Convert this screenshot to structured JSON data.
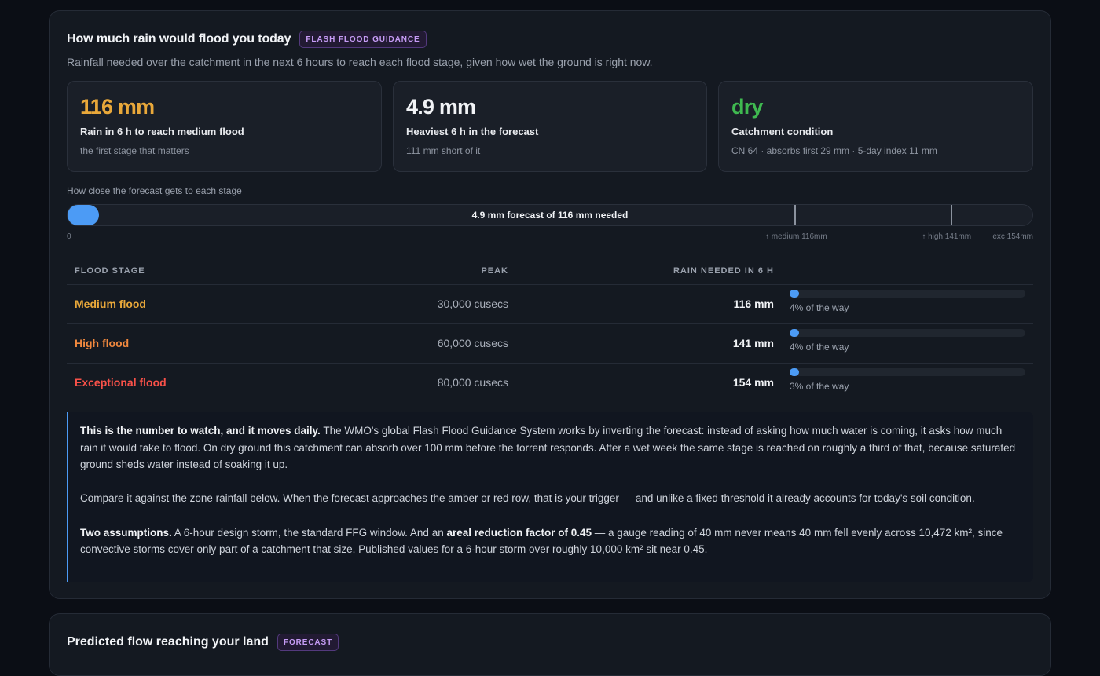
{
  "guidance": {
    "title": "How much rain would flood you today",
    "badge": "FLASH FLOOD GUIDANCE",
    "subtitle": "Rainfall needed over the catchment in the next 6 hours to reach each flood stage, given how wet the ground is right now."
  },
  "stats": [
    {
      "value": "116 mm",
      "label": "Rain in 6 h to reach medium flood",
      "sub": "the first stage that matters",
      "color": "#e9a83a"
    },
    {
      "value": "4.9 mm",
      "label": "Heaviest 6 h in the forecast",
      "sub": "111 mm short of it",
      "color": "#f1f3f6"
    },
    {
      "value": "dry",
      "label": "Catchment condition",
      "sub": "CN 64 · absorbs first 29 mm · 5-day index 11 mm",
      "color": "#3fb950"
    }
  ],
  "gauge": {
    "caption": "How close the forecast gets to each stage",
    "label": "4.9 mm forecast of 116 mm needed",
    "forecast_mm": 4.9,
    "max_mm": 154,
    "zero_label": "0",
    "markers": [
      {
        "label": "↑ medium 116mm",
        "mm": 116
      },
      {
        "label": "↑ high 141mm",
        "mm": 141
      }
    ],
    "end_label": "exc 154mm"
  },
  "table": {
    "headers": {
      "stage": "FLOOD STAGE",
      "peak": "PEAK",
      "need": "RAIN NEEDED IN 6 H"
    },
    "rows": [
      {
        "stage": "Medium flood",
        "color": "#e9a83a",
        "peak": "30,000 cusecs",
        "need": "116 mm",
        "progress_pct": 4,
        "progress_label": "4% of the way"
      },
      {
        "stage": "High flood",
        "color": "#f0883e",
        "peak": "60,000 cusecs",
        "need": "141 mm",
        "progress_pct": 4,
        "progress_label": "4% of the way"
      },
      {
        "stage": "Exceptional flood",
        "color": "#f85149",
        "peak": "80,000 cusecs",
        "need": "154 mm",
        "progress_pct": 3,
        "progress_label": "3% of the way"
      }
    ]
  },
  "note": {
    "p1_bold": "This is the number to watch, and it moves daily.",
    "p1_text": " The WMO's global Flash Flood Guidance System works by inverting the forecast: instead of asking how much water is coming, it asks how much rain it would take to flood. On dry ground this catchment can absorb over 100 mm before the torrent responds. After a wet week the same stage is reached on roughly a third of that, because saturated ground sheds water instead of soaking it up.",
    "p2_text": "Compare it against the zone rainfall below. When the forecast approaches the amber or red row, that is your trigger — and unlike a fixed threshold it already accounts for today's soil condition.",
    "p3_bold": "Two assumptions.",
    "p3_text_a": " A 6-hour design storm, the standard FFG window. And an ",
    "p3_bold2": "areal reduction factor of 0.45",
    "p3_text_b": " — a gauge reading of 40 mm never means 40 mm fell evenly across 10,472 km², since convective storms cover only part of a catchment that size. Published values for a 6-hour storm over roughly 10,000 km² sit near 0.45."
  },
  "next_section": {
    "title": "Predicted flow reaching your land",
    "badge": "FORECAST"
  }
}
